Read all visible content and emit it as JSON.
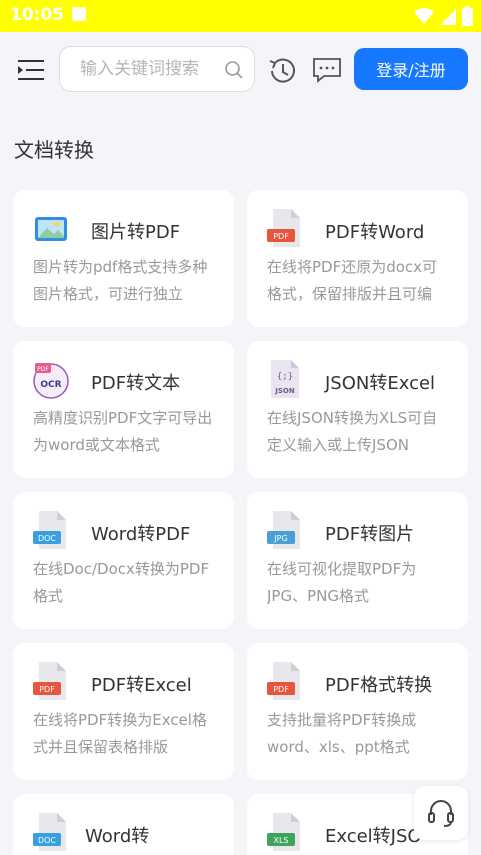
{
  "status": {
    "time": "10:05"
  },
  "header": {
    "search_placeholder": "输入关键词搜索",
    "login_label": "登录/注册"
  },
  "section": {
    "title": "文档转换"
  },
  "tools": [
    {
      "title": "图片转PDF",
      "desc": "图片转为pdf格式支持多种图片格式，可进行独立",
      "icon": "image-icon",
      "badge": ""
    },
    {
      "title": "PDF转Word",
      "desc": "在线将PDF还原为docx可格式，保留排版并且可编",
      "icon": "pdf-file-icon",
      "badge": "PDF"
    },
    {
      "title": "PDF转文本",
      "desc": "高精度识别PDF文字可导出为word或文本格式",
      "icon": "ocr-icon",
      "badge": "OCR"
    },
    {
      "title": "JSON转Excel",
      "desc": "在线JSON转换为XLS可自定义输入或上传JSON",
      "icon": "json-file-icon",
      "badge": "JSON"
    },
    {
      "title": "Word转PDF",
      "desc": "在线Doc/Docx转换为PDF格式",
      "icon": "doc-file-icon",
      "badge": "DOC"
    },
    {
      "title": "PDF转图片",
      "desc": "在线可视化提取PDF为JPG、PNG格式",
      "icon": "jpg-file-icon",
      "badge": "JPG"
    },
    {
      "title": "PDF转Excel",
      "desc": "在线将PDF转换为Excel格式并且保留表格排版",
      "icon": "pdf-file-icon",
      "badge": "PDF"
    },
    {
      "title": "PDF格式转换",
      "desc": "支持批量将PDF转换成word、xls、ppt格式",
      "icon": "pdf-file-icon",
      "badge": "PDF"
    },
    {
      "title": "Word转",
      "desc": "",
      "icon": "doc-file-icon",
      "badge": "DOC"
    },
    {
      "title": "Excel转JSO",
      "desc": "",
      "icon": "xls-file-icon",
      "badge": "XLS"
    }
  ]
}
